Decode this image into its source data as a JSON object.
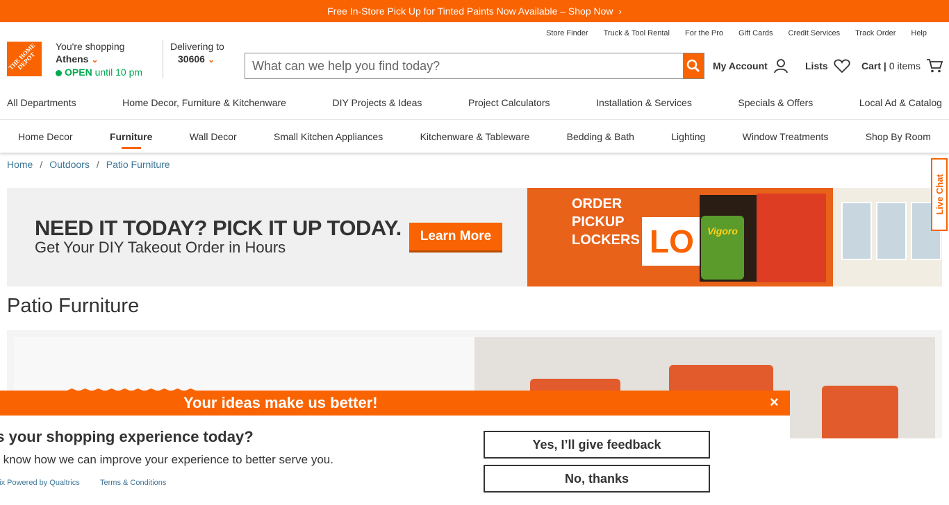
{
  "promo": {
    "text": "Free In-Store Pick Up for Tinted Paints Now Available – Shop Now",
    "chevron": "›"
  },
  "logo": {
    "text": "THE HOME DEPOT"
  },
  "store": {
    "shopping_label": "You're shopping",
    "city": "Athens",
    "open": "OPEN",
    "until": "until 10 pm"
  },
  "delivery": {
    "label": "Delivering to",
    "zip": "30606"
  },
  "utility_links": [
    "Store Finder",
    "Truck & Tool Rental",
    "For the Pro",
    "Gift Cards",
    "Credit Services",
    "Track Order",
    "Help"
  ],
  "search": {
    "placeholder": "What can we help you find today?"
  },
  "account": {
    "my_account": "My Account",
    "lists": "Lists",
    "cart": "Cart |",
    "cart_count": "0 items"
  },
  "main_nav": [
    "All Departments",
    "Home Decor, Furniture & Kitchenware",
    "DIY Projects & Ideas",
    "Project Calculators",
    "Installation & Services",
    "Specials & Offers",
    "Local Ad & Catalog"
  ],
  "sub_nav": [
    {
      "label": "Home Decor",
      "active": false
    },
    {
      "label": "Furniture",
      "active": true
    },
    {
      "label": "Wall Decor",
      "active": false
    },
    {
      "label": "Small Kitchen Appliances",
      "active": false
    },
    {
      "label": "Kitchenware & Tableware",
      "active": false
    },
    {
      "label": "Bedding & Bath",
      "active": false
    },
    {
      "label": "Lighting",
      "active": false
    },
    {
      "label": "Window Treatments",
      "active": false
    },
    {
      "label": "Shop By Room",
      "active": false
    }
  ],
  "breadcrumb": [
    "Home",
    "Outdoors",
    "Patio Furniture"
  ],
  "banner": {
    "headline": "NEED IT TODAY? PICK IT UP TODAY.",
    "subhead": "Get Your DIY Takeout Order in Hours",
    "cta": "Learn More",
    "locker_text": [
      "ORDER",
      "PICKUP",
      "LOCKERS"
    ],
    "locker_logo": "LO",
    "bag_brand": "Vigoro"
  },
  "page_title": "Patio Furniture",
  "live_chat": "Live Chat",
  "feedback": {
    "header": "Your ideas make us better!",
    "close": "×",
    "question": "as your shopping experience today?",
    "description": "us know how we can improve your experience to better serve you.",
    "powered_by": "ltrix Powered by Qualtrics",
    "terms": "Terms & Conditions",
    "yes": "Yes, I’ll give feedback",
    "no": "No, thanks"
  },
  "colors": {
    "brand_orange": "#f96302",
    "open_green": "#00a950",
    "link_blue": "#3e7697"
  }
}
